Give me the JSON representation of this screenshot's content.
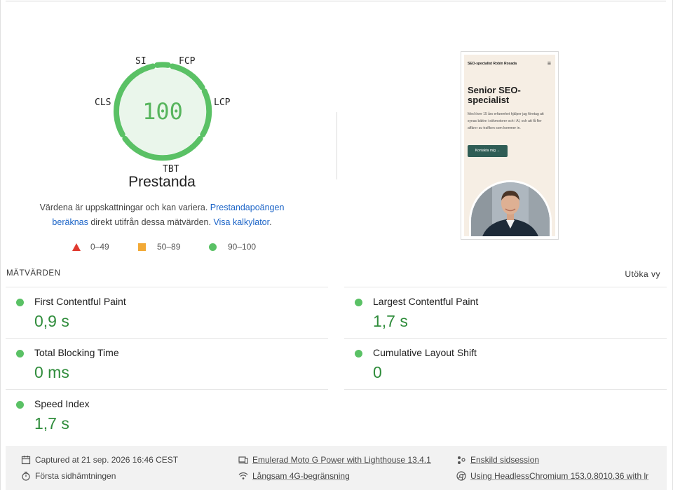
{
  "gauge": {
    "score": "100",
    "title": "Prestanda",
    "tags": {
      "si": "SI",
      "fcp": "FCP",
      "lcp": "LCP",
      "tbt": "TBT",
      "cls": "CLS"
    },
    "color": "#5ac165"
  },
  "description": {
    "text1": "Värdena är uppskattningar och kan variera. ",
    "link1": "Prestandapoängen beräknas",
    "text2": " direkt utifrån dessa mätvärden. ",
    "link2": "Visa kalkylator",
    "text3": "."
  },
  "legend": {
    "fail": "0–49",
    "average": "50–89",
    "pass": "90–100"
  },
  "screenshot": {
    "brand": "SEO-specialist Robin Rosada",
    "menu_icon": "hamburger-icon",
    "hero": "Senior SEO-specialist",
    "body": "Med över 15 års erfarenhet hjälper jag företag att synas bättre i sökmotorer och i AI, och att få fler affärer av trafiken som kommer in.",
    "button": "Kontakta mig →"
  },
  "metrics": {
    "title": "MÄTVÄRDEN",
    "expand": "Utöka vy",
    "items": [
      {
        "label": "First Contentful Paint",
        "value": "0,9 s"
      },
      {
        "label": "Largest Contentful Paint",
        "value": "1,7 s"
      },
      {
        "label": "Total Blocking Time",
        "value": "0 ms"
      },
      {
        "label": "Cumulative Layout Shift",
        "value": "0"
      },
      {
        "label": "Speed Index",
        "value": "1,7 s"
      }
    ]
  },
  "footer": {
    "captured": "Captured at 21 sep. 2026 16:46 CEST",
    "first_load": "Första sidhämtningen",
    "device": "Emulerad Moto G Power with Lighthouse 13.4.1",
    "throttling": "Långsam 4G-begränsning",
    "session": "Enskild sidsession",
    "browser": "Using HeadlessChromium 153.0.8010.36 with lr"
  }
}
